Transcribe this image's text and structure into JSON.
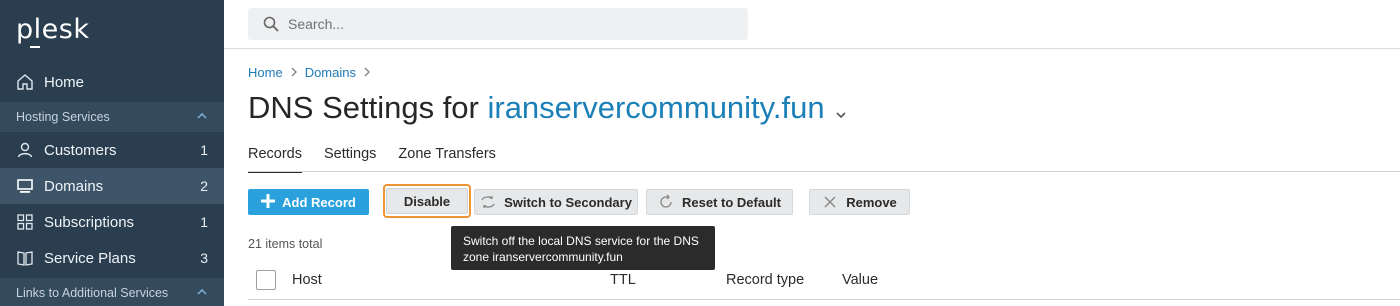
{
  "sidebar": {
    "logo": "plesk",
    "home": "Home",
    "hosting_section": "Hosting Services",
    "items": [
      {
        "label": "Customers",
        "count": "1",
        "icon": "user-icon"
      },
      {
        "label": "Domains",
        "count": "2",
        "icon": "monitor-icon"
      },
      {
        "label": "Subscriptions",
        "count": "1",
        "icon": "grid-icon"
      },
      {
        "label": "Service Plans",
        "count": "3",
        "icon": "book-icon"
      }
    ],
    "links_section": "Links to Additional Services"
  },
  "search": {
    "placeholder": "Search..."
  },
  "breadcrumb": [
    "Home",
    "Domains"
  ],
  "page": {
    "title_prefix": "DNS Settings for ",
    "domain": "iranservercommunity.fun"
  },
  "tabs": [
    "Records",
    "Settings",
    "Zone Transfers"
  ],
  "toolbar": {
    "add": "Add Record",
    "disable": "Disable",
    "switch": "Switch to Secondary",
    "reset": "Reset to Default",
    "remove": "Remove"
  },
  "tooltip": "Switch off the local DNS service for the DNS zone iranservercommunity.fun",
  "items_total": "21 items total",
  "table": {
    "columns": [
      "Host",
      "TTL",
      "Record type",
      "Value"
    ]
  },
  "colors": {
    "sidebar": "#2b3e4f",
    "accent": "#1c80b8",
    "primary_button": "#2aa0dc",
    "focus": "#ef9434"
  }
}
